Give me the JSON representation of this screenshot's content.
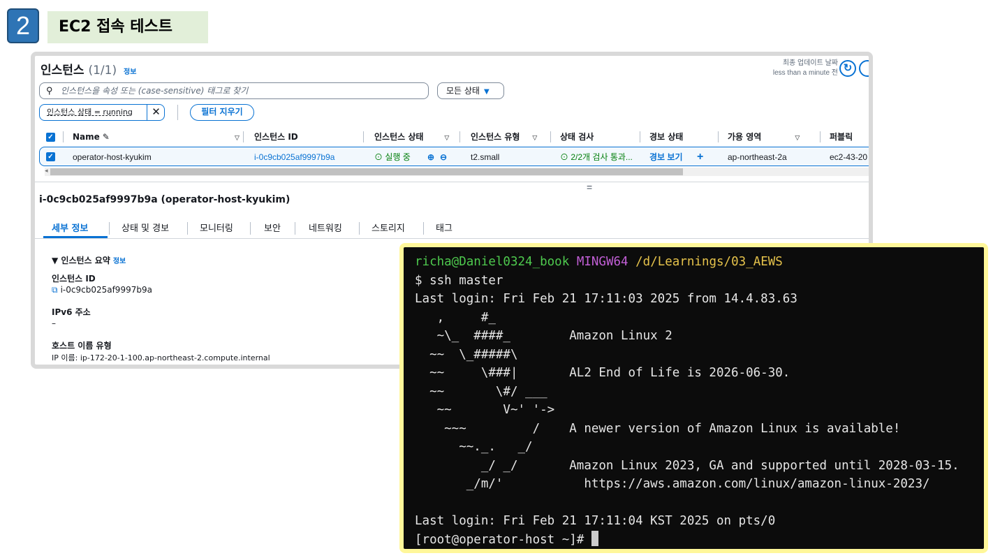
{
  "slide": {
    "step_number": "2",
    "title": "EC2 접속 테스트"
  },
  "console": {
    "header": {
      "title": "인스턴스",
      "count": "(1/1)",
      "info_link": "정보",
      "last_updated_label": "최종 업데이트 날짜",
      "last_updated_value": "less than a minute 전"
    },
    "search": {
      "placeholder": "인스턴스을 속성 또는 (case-sensitive) 태그로 찾기"
    },
    "state_filter": {
      "selected": "모든 상태"
    },
    "filter_chip": {
      "label": "인스턴스 상태 = running"
    },
    "clear_filters_label": "필터 지우기",
    "columns": [
      "Name",
      "인스턴스 ID",
      "인스턴스 상태",
      "인스턴스 유형",
      "상태 검사",
      "경보 상태",
      "가용 영역",
      "퍼블릭 IPv"
    ],
    "rows": [
      {
        "name": "operator-host-kyukim",
        "instance_id": "i-0c9cb025af9997b9a",
        "state": "실행 중",
        "type": "t2.small",
        "status_check": "2/2개 검사 통과...",
        "alarm": "경보 보기",
        "az": "ap-northeast-2a",
        "public_ip": "ec2-43-20"
      }
    ],
    "detail": {
      "title": "i-0c9cb025af9997b9a (operator-host-kyukim)",
      "tabs": [
        "세부 정보",
        "상태 및 경보",
        "모니터링",
        "보안",
        "네트워킹",
        "스토리지",
        "태그"
      ],
      "summary_title": "인스턴스 요약",
      "summary_info": "정보",
      "fields": [
        {
          "label": "인스턴스 ID",
          "value": "i-0c9cb025af9997b9a"
        },
        {
          "label": "IPv6 주소",
          "value": "–"
        },
        {
          "label": "호스트 이름 유형",
          "value": "IP 이름: ip-172-20-1-100.ap-northeast-2.compute.internal"
        }
      ]
    }
  },
  "terminal": {
    "prompt_user": "richa@Daniel0324_book",
    "prompt_env": "MINGW64",
    "prompt_path": "/d/Learnings/03_AEWS",
    "lines": [
      "$ ssh master",
      "Last login: Fri Feb 21 17:11:03 2025 from 14.4.83.63",
      "   ,     #_",
      "   ~\\_  ####_        Amazon Linux 2",
      "  ~~  \\_#####\\",
      "  ~~     \\###|       AL2 End of Life is 2026-06-30.",
      "  ~~       \\#/ ___",
      "   ~~       V~' '->",
      "    ~~~         /    A newer version of Amazon Linux is available!",
      "      ~~._.   _/",
      "         _/ _/       Amazon Linux 2023, GA and supported until 2028-03-15.",
      "       _/m/'           https://aws.amazon.com/linux/amazon-linux-2023/",
      "",
      "Last login: Fri Feb 21 17:11:04 KST 2025 on pts/0"
    ],
    "final_prompt": "[root@operator-host ~]# "
  },
  "colors": {
    "accent": "#0972d3",
    "success": "#037f0c",
    "terminal_bg": "#0c0c0c",
    "terminal_border": "#fff79a",
    "title_bg": "#e2efd9",
    "badge_bg": "#2e74b5"
  }
}
